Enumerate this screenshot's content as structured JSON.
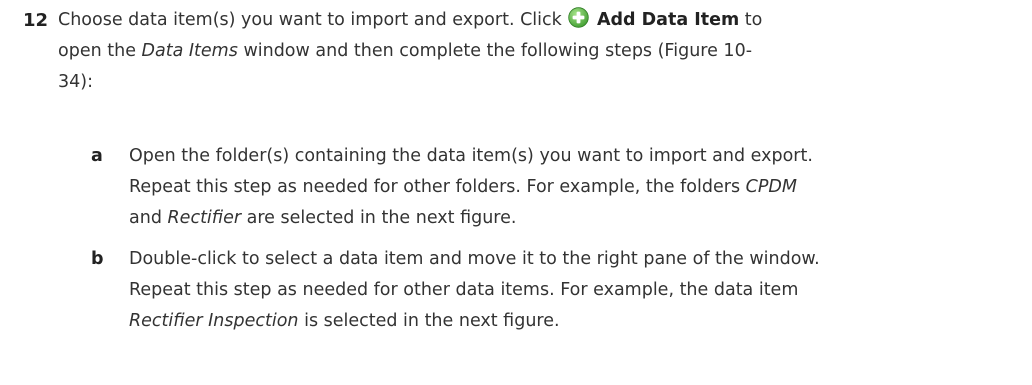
{
  "step": {
    "number": "12",
    "line1_pre": "Choose data item(s) you want to import and export. Click",
    "button_label": "Add Data Item",
    "line1_post": "to",
    "line2_pre": "open the",
    "window_name": "Data Items",
    "line2_post": "window and then complete the following steps (Figure 10-",
    "line3": "34):"
  },
  "substeps": [
    {
      "letter": "a",
      "line1": "Open the folder(s) containing the data item(s) you want to import and export.",
      "line2": "Repeat this step as needed for other folders. For example, the folders",
      "folder1": "CPDM",
      "connector": "and",
      "folder2": "Rectifier",
      "line3_post": "are selected in the next figure."
    },
    {
      "letter": "b",
      "line1": "Double-click to select a data item and move it to the right pane of the window.",
      "line2": "Repeat this step as needed for other data items. For example, the data item",
      "item": "Rectifier Inspection",
      "line3_post": "is selected in the next figure."
    }
  ],
  "icons": {
    "add_icon": "add-plus-circle-icon",
    "add_icon_color": "#4caf3c",
    "add_icon_highlight": "#8ed86f"
  }
}
